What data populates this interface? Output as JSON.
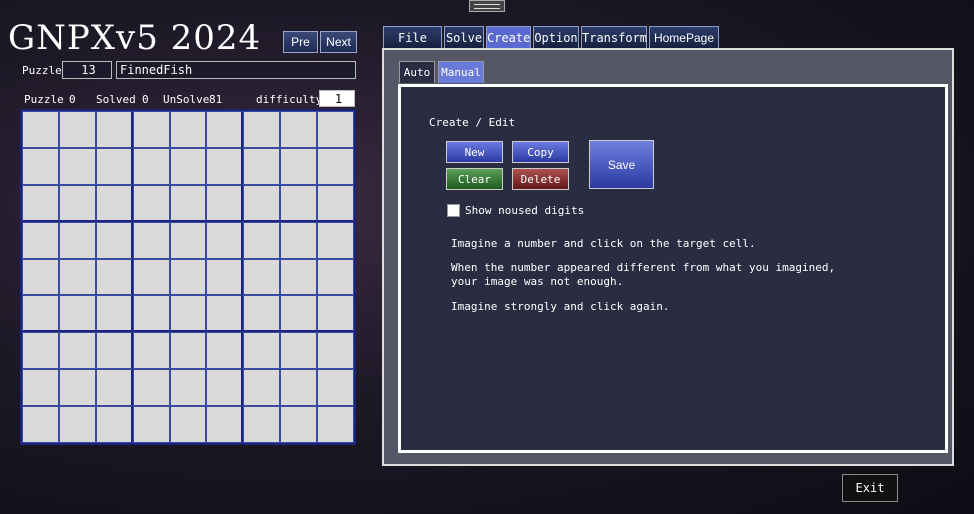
{
  "app": {
    "title": "GNPXv5 2024"
  },
  "nav": {
    "pre": "Pre",
    "next": "Next"
  },
  "puzzle": {
    "label": "Puzzle",
    "number": "13",
    "name": "FinnedFish"
  },
  "stats": {
    "puzzle_label": "Puzzle",
    "puzzle_value": "0",
    "solved_label": "Solved",
    "solved_value": "0",
    "unsolve_label": "UnSolve",
    "unsolve_value": "81",
    "difficulty_label": "difficulty",
    "difficulty_value": "1"
  },
  "tabs": [
    "File",
    "Solve",
    "Create",
    "Option",
    "Transform",
    "HomePage"
  ],
  "active_tab": "Create",
  "subtabs": [
    "Auto",
    "Manual"
  ],
  "active_subtab": "Manual",
  "create": {
    "section_label": "Create / Edit",
    "new": "New",
    "copy": "Copy",
    "save": "Save",
    "clear": "Clear",
    "delete": "Delete",
    "checkbox_label": "Show noused digits",
    "line1": "Imagine a number and click on the target cell.",
    "line2": "When the number appeared different from what you imagined,",
    "line3": "your image was not enough.",
    "line4": "Imagine strongly and click again."
  },
  "exit": "Exit",
  "colors": {
    "grid_bg": "#d9d9d9",
    "grid_line": "#1a237e",
    "active_tab": "#5a6ad0"
  }
}
